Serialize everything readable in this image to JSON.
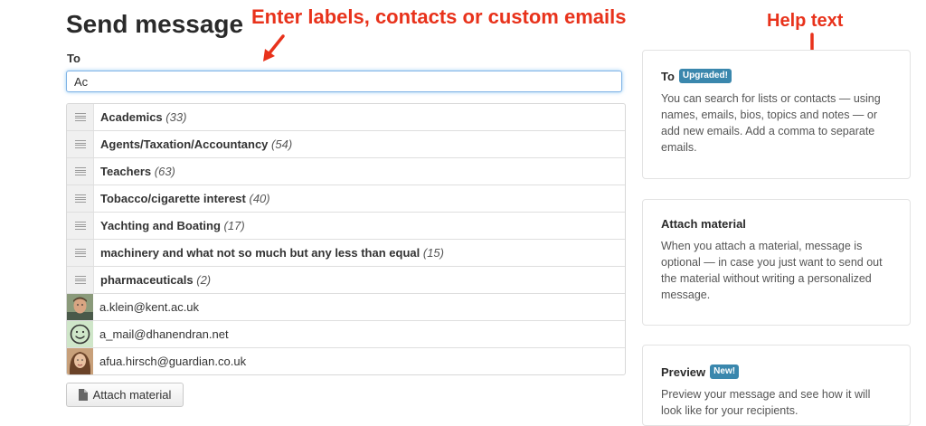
{
  "page": {
    "title": "Send message"
  },
  "annotations": {
    "main": "Enter labels, contacts or custom emails",
    "help": "Help text",
    "color": "#e8321b"
  },
  "form": {
    "to_label": "To",
    "to_value": "Ac"
  },
  "suggestions": {
    "labels": [
      {
        "name": "Academics",
        "count": "(33)"
      },
      {
        "name": "Agents/Taxation/Accountancy",
        "count": "(54)"
      },
      {
        "name": "Teachers",
        "count": "(63)"
      },
      {
        "name": "Tobacco/cigarette interest",
        "count": "(40)"
      },
      {
        "name": "Yachting and Boating",
        "count": "(17)"
      },
      {
        "name": "machinery and what not so much but any less than equal",
        "count": "(15)"
      },
      {
        "name": "pharmaceuticals",
        "count": "(2)"
      }
    ],
    "contacts": [
      {
        "email": "a.klein@kent.ac.uk",
        "avatar": "photo-avatar"
      },
      {
        "email": "a_mail@dhanendran.net",
        "avatar": "smiley-avatar"
      },
      {
        "email": "afua.hirsch@guardian.co.uk",
        "avatar": "photo-avatar"
      }
    ]
  },
  "attach_button": {
    "label": "Attach material",
    "icon": "document-icon"
  },
  "help_panels": [
    {
      "title": "To",
      "badge": "Upgraded!",
      "text": "You can search for lists or contacts — using names, emails, bios, topics and notes — or add new emails. Add a comma to separate emails."
    },
    {
      "title": "Attach material",
      "text": "When you attach a material, message is optional — in case you just want to send out the material without writing a personalized message."
    },
    {
      "title": "Preview",
      "badge": "New!",
      "text": "Preview your message and see how it will look like for your recipients."
    }
  ],
  "colors": {
    "badge": "#3a87ad",
    "focus": "#7fb3e6"
  }
}
